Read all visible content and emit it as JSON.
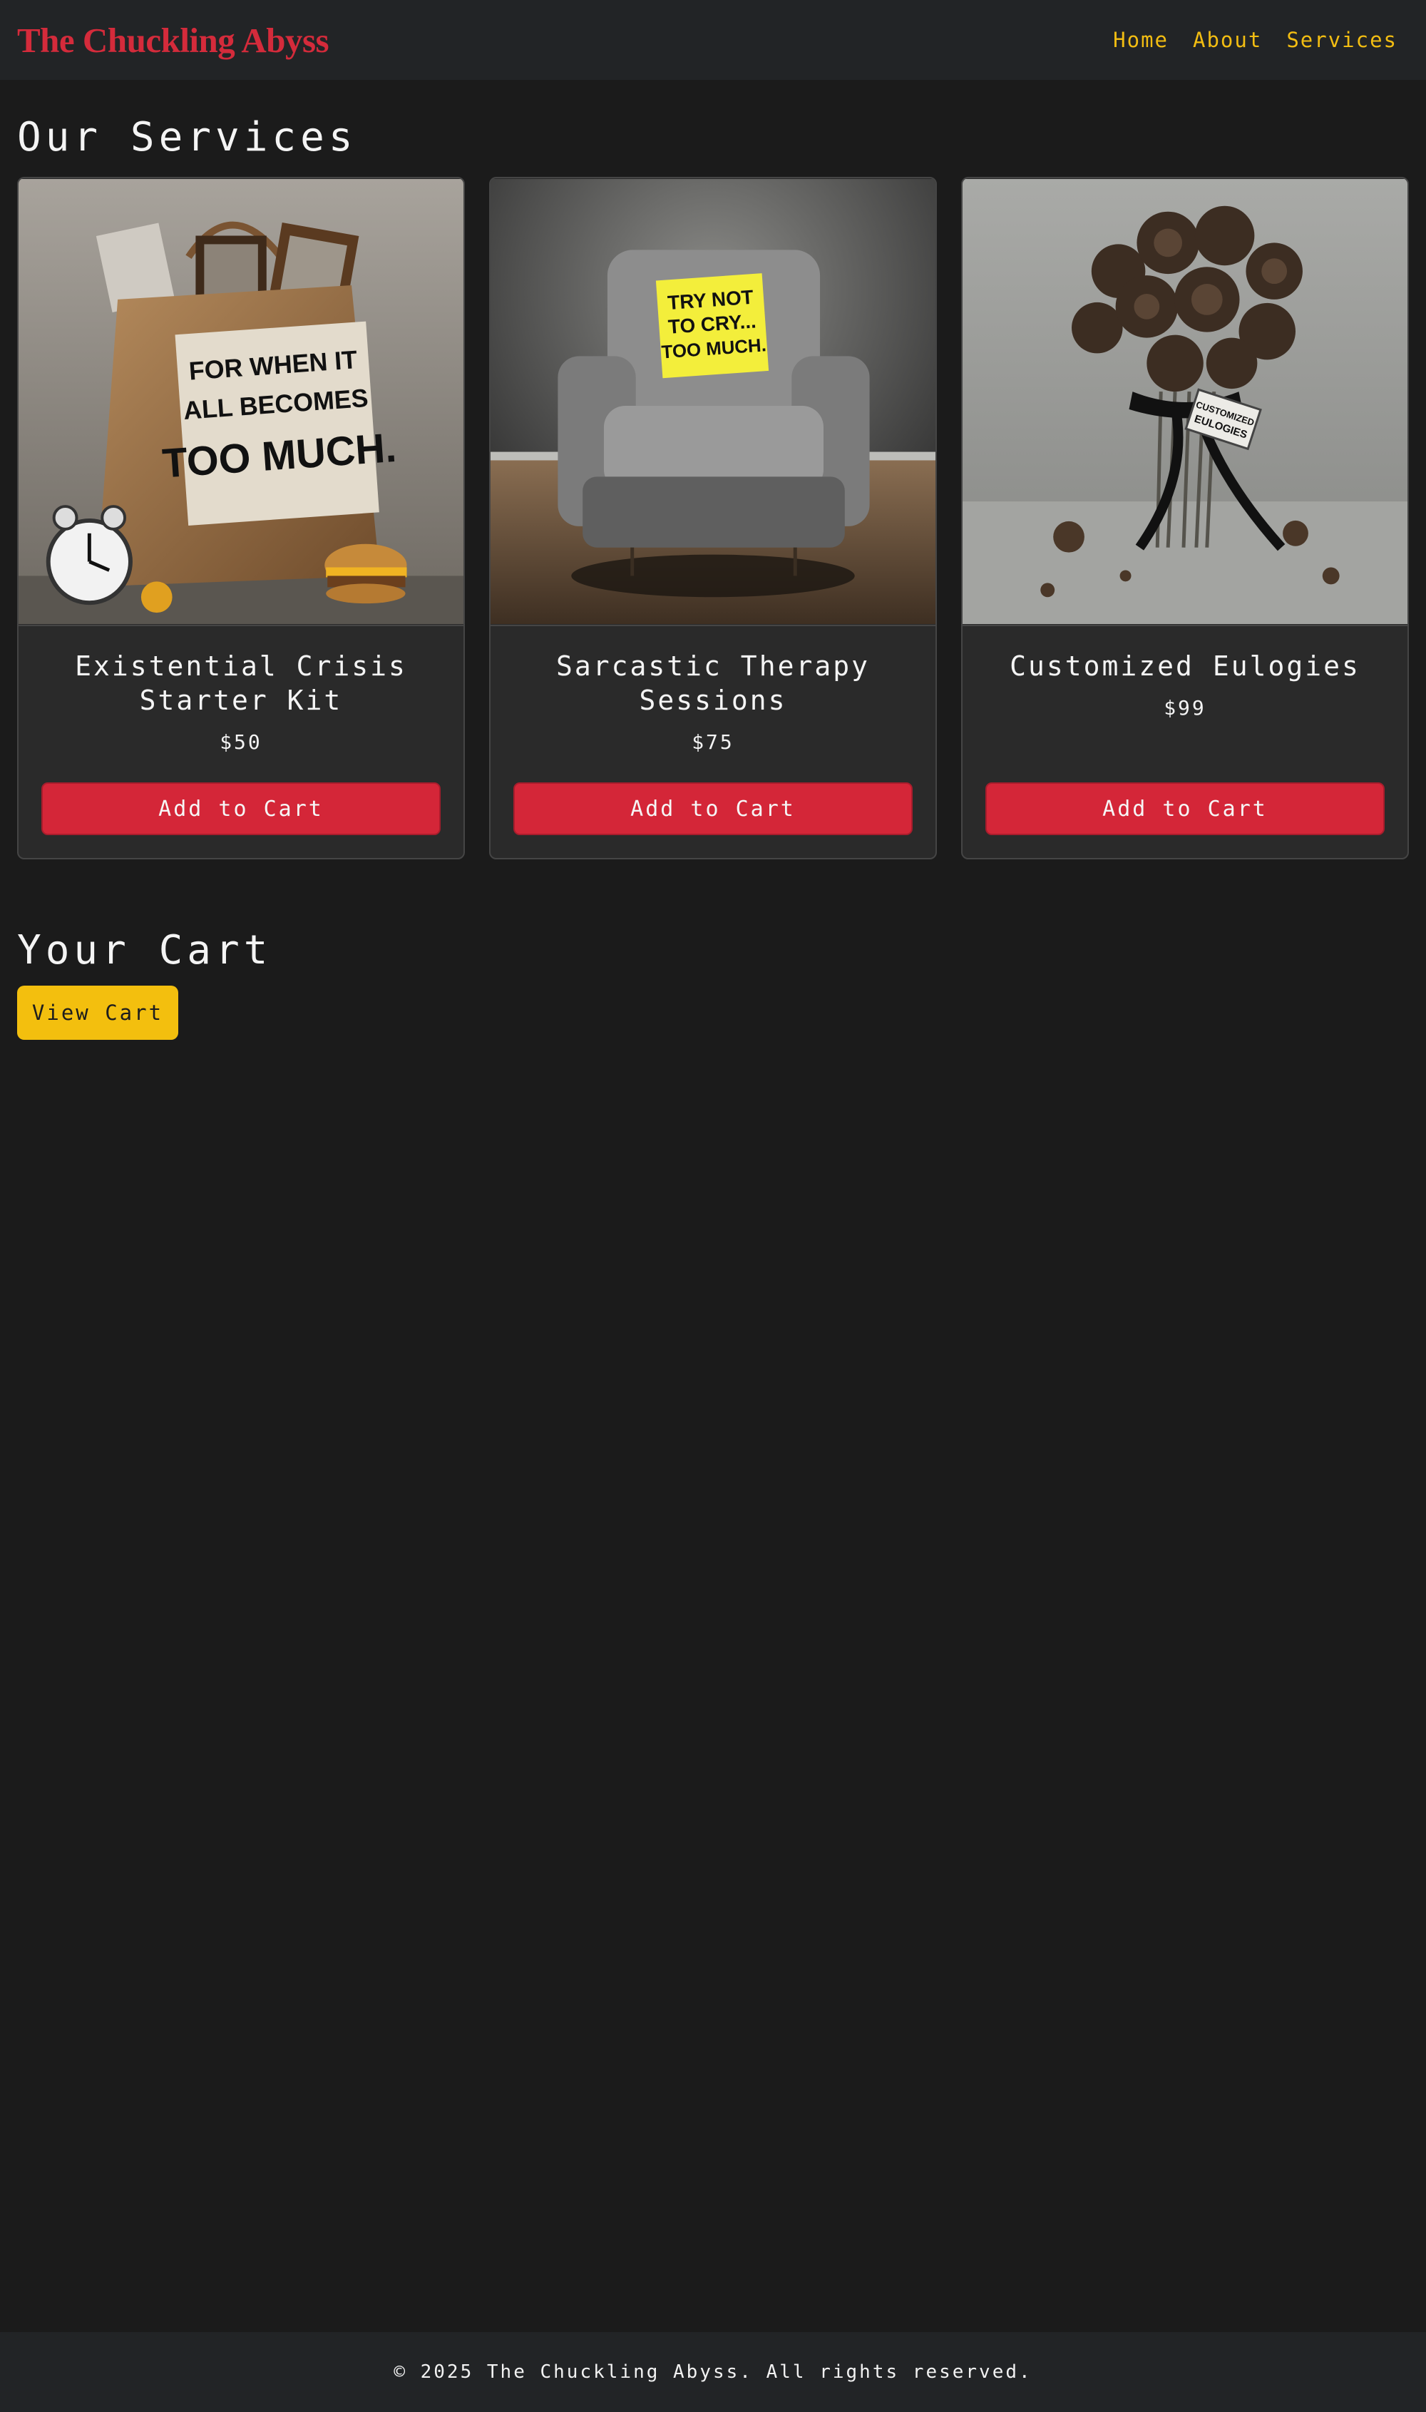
{
  "header": {
    "brand": "The Chuckling Abyss",
    "nav": [
      "Home",
      "About",
      "Services"
    ]
  },
  "services": {
    "title": "Our Services",
    "items": [
      {
        "title": "Existential Crisis Starter Kit",
        "price": "$50",
        "button": "Add to Cart",
        "image_text": [
          "FOR WHEN IT",
          "ALL BECOMES",
          "TOO MUCH."
        ]
      },
      {
        "title": "Sarcastic Therapy Sessions",
        "price": "$75",
        "button": "Add to Cart",
        "image_text": [
          "TRY NOT",
          "TO CRY...",
          "TOO MUCH."
        ]
      },
      {
        "title": "Customized Eulogies",
        "price": "$99",
        "button": "Add to Cart",
        "image_text": [
          "CUSTOMIZED",
          "EULOGIES"
        ]
      }
    ]
  },
  "cart": {
    "title": "Your Cart",
    "button": "View Cart"
  },
  "footer": {
    "text": "© 2025 The Chuckling Abyss. All rights reserved."
  },
  "colors": {
    "brand": "#d42b3b",
    "nav_link": "#f2bd12",
    "add_button": "#d42638",
    "view_cart_button": "#f3bf0e",
    "background": "#1b1b1b"
  }
}
